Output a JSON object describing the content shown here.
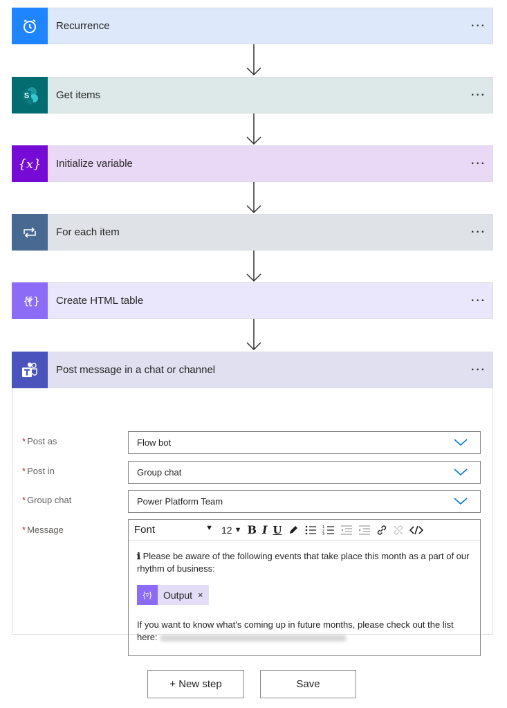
{
  "steps": [
    {
      "title": "Recurrence",
      "icon": "alarm-clock-icon",
      "header_bg": "#dde9fb",
      "icon_bg": "#1f85ff"
    },
    {
      "title": "Get items",
      "icon": "sharepoint-icon",
      "header_bg": "#dce9e8",
      "icon_bg": "#036c70"
    },
    {
      "title": "Initialize variable",
      "icon": "variable-icon",
      "header_bg": "#ead9f6",
      "icon_bg": "#770bd6"
    },
    {
      "title": "For each item",
      "icon": "loop-icon",
      "header_bg": "#dfe3e8",
      "icon_bg": "#486991"
    },
    {
      "title": "Create HTML table",
      "icon": "data-operation-icon",
      "header_bg": "#eae6fc",
      "icon_bg": "#8c6cf6"
    },
    {
      "title": "Post message in a chat or channel",
      "icon": "teams-icon",
      "header_bg": "#e0e0f0",
      "icon_bg": "#4b53bc"
    }
  ],
  "more_label": "···",
  "form": {
    "required_mark": "*",
    "post_as": {
      "label": "Post as",
      "value": "Flow bot"
    },
    "post_in": {
      "label": "Post in",
      "value": "Group chat"
    },
    "group_chat": {
      "label": "Group chat",
      "value": "Power Platform Team"
    },
    "message": {
      "label": "Message",
      "toolbar": {
        "font": "Font",
        "size": "12"
      },
      "info_glyph": "ℹ",
      "line1": "Please be aware of the following events that take place this month as a part of our rhythm of business:",
      "token_label": "Output",
      "token_close": "×",
      "line2": "If you want to know what's coming up in future months, please check out the list here:"
    }
  },
  "buttons": {
    "new_step": "+ New step",
    "save": "Save"
  },
  "colors": {
    "accent": "#0078d4",
    "required": "#a4262c"
  }
}
